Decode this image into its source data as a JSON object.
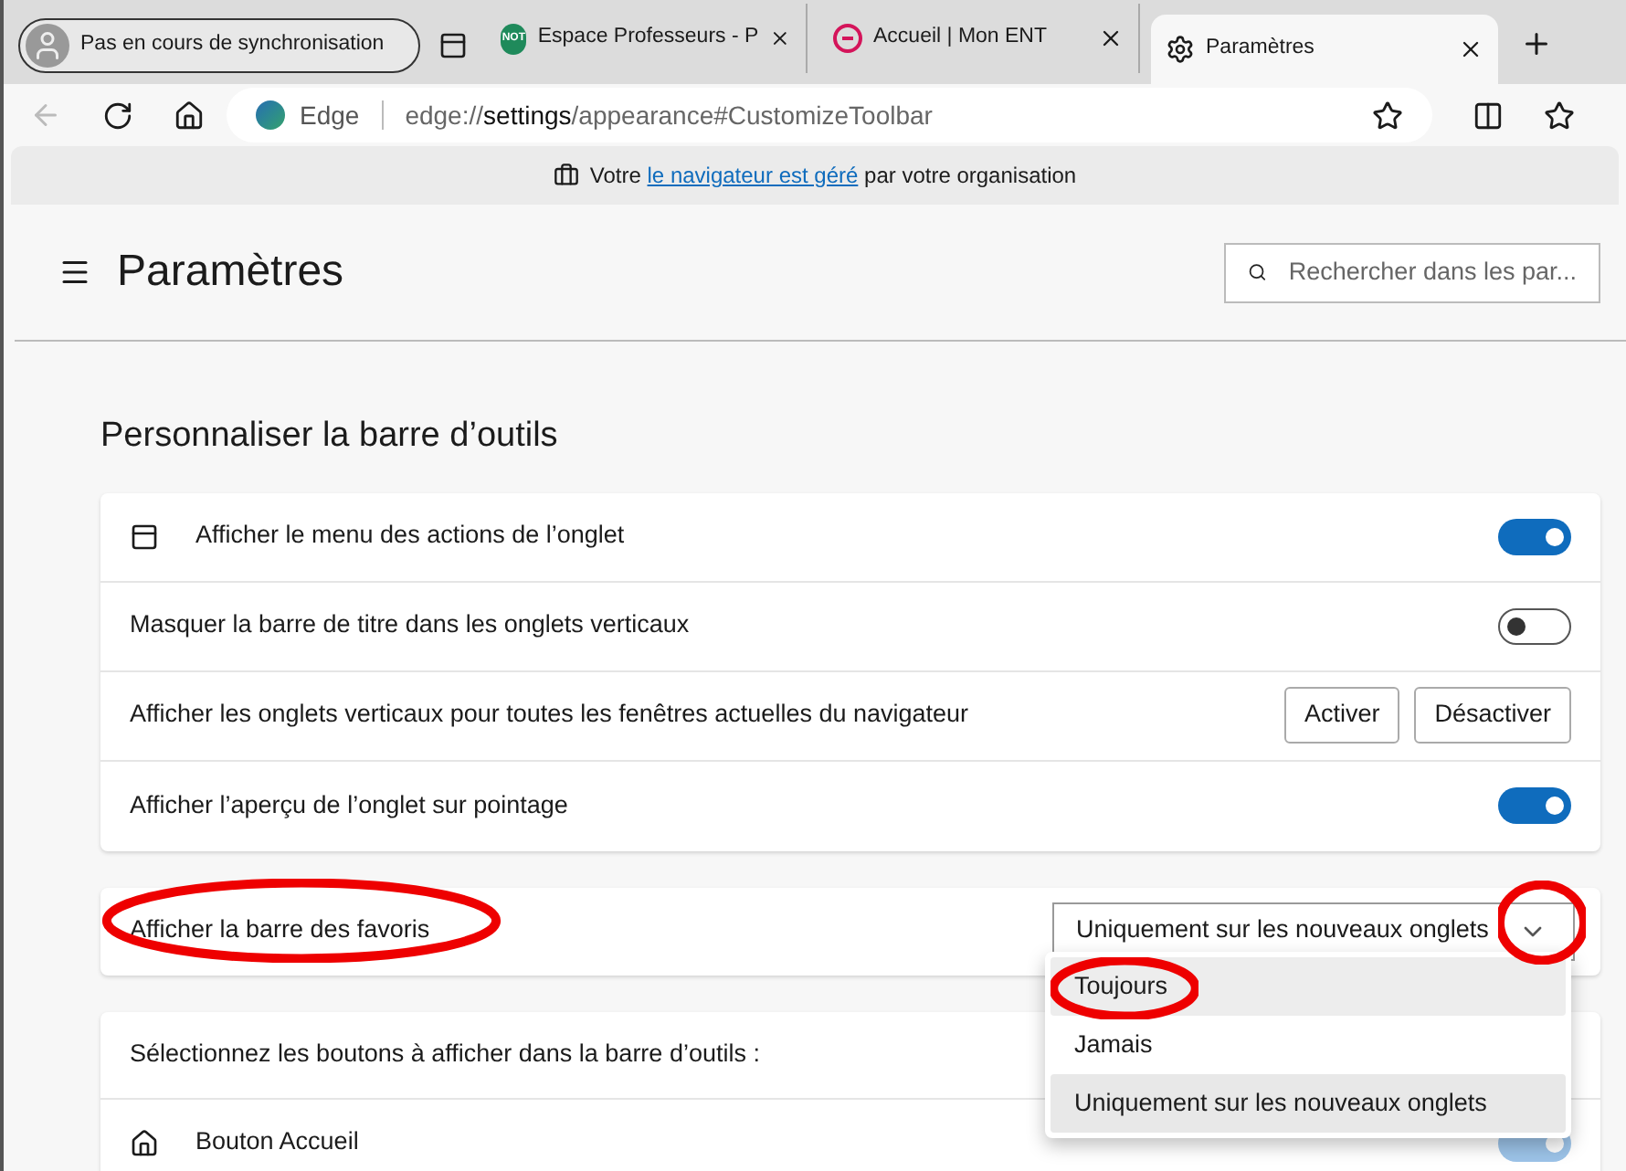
{
  "profile": {
    "label": "Pas en cours de synchronisation"
  },
  "tabs": [
    {
      "title": "Espace Professeurs - P",
      "icon": "NOT",
      "kind": "note",
      "selected": false
    },
    {
      "title": "Accueil | Mon ENT",
      "kind": "ent",
      "selected": false
    },
    {
      "title": "Paramètres",
      "kind": "settings",
      "selected": true
    }
  ],
  "address": {
    "brand": "Edge",
    "scheme": "edge://",
    "host": "settings",
    "path": "/appearance#CustomizeToolbar"
  },
  "banner": {
    "before": "Votre",
    "link": "le navigateur est géré",
    "after": "par votre organisation"
  },
  "header": {
    "title": "Paramètres",
    "search_placeholder": "Rechercher dans les par..."
  },
  "section_title": "Personnaliser la barre d’outils",
  "settings": [
    {
      "kind": "toggle",
      "icon": true,
      "label": "Afficher le menu des actions de l’onglet",
      "on": true
    },
    {
      "kind": "toggle",
      "icon": false,
      "label": "Masquer la barre de titre dans les onglets verticaux",
      "on": false
    },
    {
      "kind": "buttons",
      "label": "Afficher les onglets verticaux pour toutes les fenêtres actuelles du navigateur",
      "buttons": [
        "Activer",
        "Désactiver"
      ]
    },
    {
      "kind": "toggle",
      "icon": false,
      "label": "Afficher l’aperçu de l’onglet sur pointage",
      "on": true
    }
  ],
  "favorites": {
    "label": "Afficher la barre des favoris",
    "value": "Uniquement sur les nouveaux onglets",
    "expanded": true,
    "options": [
      {
        "label": "Toujours",
        "selected": false,
        "hovered": true
      },
      {
        "label": "Jamais",
        "selected": false,
        "hovered": false
      },
      {
        "label": "Uniquement sur les nouveaux onglets",
        "selected": true,
        "hovered": false
      }
    ]
  },
  "toolbar_buttons": {
    "title": "Sélectionnez les boutons à afficher dans la barre d’outils :",
    "items": [
      {
        "label": "Bouton Accueil",
        "on": true
      }
    ]
  }
}
